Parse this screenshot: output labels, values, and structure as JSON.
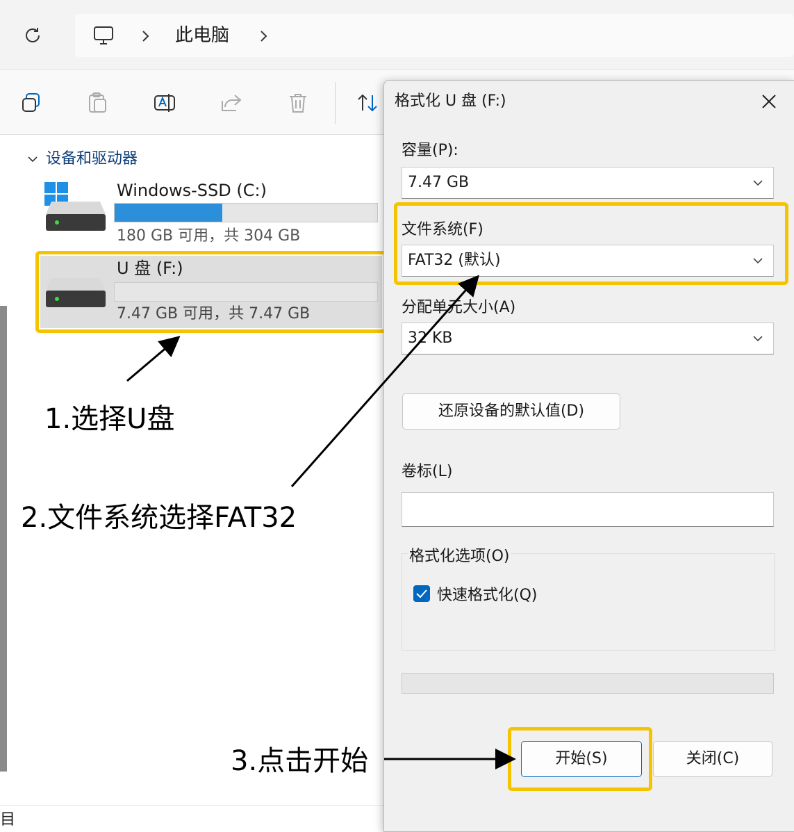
{
  "address": {
    "crumb": "此电脑"
  },
  "nav": {
    "section_title": "设备和驱动器"
  },
  "drives": [
    {
      "name": "Windows-SSD (C:)",
      "usage": "180 GB 可用，共 304 GB",
      "used_fraction": 0.41
    },
    {
      "name": "U 盘 (F:)",
      "usage": "7.47 GB 可用，共 7.47 GB",
      "used_fraction": 0.0
    }
  ],
  "status": {
    "left_text": "目"
  },
  "dialog": {
    "title": "格式化 U 盘 (F:)",
    "capacity_label": "容量(P):",
    "capacity_value": "7.47 GB",
    "fs_label": "文件系统(F)",
    "fs_value": "FAT32 (默认)",
    "alloc_label": "分配单元大小(A)",
    "alloc_value": "32 KB",
    "restore_button": "还原设备的默认值(D)",
    "volume_label": "卷标(L)",
    "volume_value": "",
    "options_group": "格式化选项(O)",
    "quick_format_label": "快速格式化(Q)",
    "quick_format_checked": true,
    "progress_fraction": 0,
    "start_button": "开始(S)",
    "close_button": "关闭(C)"
  },
  "annotations": {
    "step1": "1.选择U盘",
    "step2": "2.文件系统选择FAT32",
    "step3": "3.点击开始"
  },
  "colors": {
    "highlight": "#f5c400",
    "accent": "#0067c0",
    "drive_bar_fill": "#2b8fd9"
  }
}
